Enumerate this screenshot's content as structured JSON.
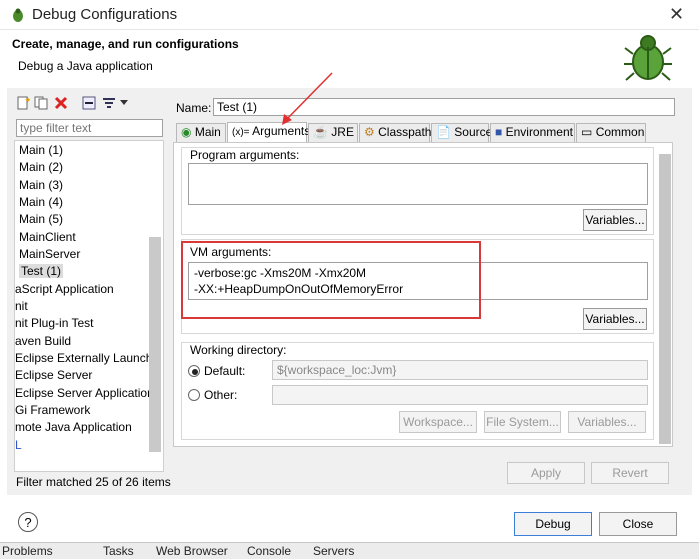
{
  "window": {
    "title": "Debug Configurations",
    "close_icon": "close-icon"
  },
  "header": {
    "heading": "Create, manage, and run configurations",
    "subheading": "Debug a Java application"
  },
  "left": {
    "filter_placeholder": "type filter text",
    "items": [
      {
        "label": "Main (1)"
      },
      {
        "label": "Main (2)"
      },
      {
        "label": "Main (3)"
      },
      {
        "label": "Main (4)"
      },
      {
        "label": "Main (5)"
      },
      {
        "label": "MainClient"
      },
      {
        "label": "MainServer"
      },
      {
        "label": "Test (1)",
        "selected": true
      },
      {
        "label": "aScript Application"
      },
      {
        "label": "nit"
      },
      {
        "label": "nit Plug-in Test"
      },
      {
        "label": "aven Build"
      },
      {
        "label": "Eclipse Externally Launche"
      },
      {
        "label": "Eclipse Server"
      },
      {
        "label": "Eclipse Server Application"
      },
      {
        "label": "Gi Framework"
      },
      {
        "label": "mote Java Application"
      },
      {
        "label": "L"
      }
    ],
    "status": "Filter matched 25 of 26 items"
  },
  "right": {
    "name_label": "Name:",
    "name_value": "Test (1)",
    "tabs": [
      "Main",
      "Arguments",
      "JRE",
      "Classpath",
      "Source",
      "Environment",
      "Common"
    ],
    "program_args_label": "Program arguments:",
    "variables_btn": "Variables...",
    "vm_args_label": "VM arguments:",
    "vm_args_line1": "-verbose:gc -Xms20M -Xmx20M",
    "vm_args_line2": "-XX:+HeapDumpOnOutOfMemoryError",
    "workdir_label": "Working directory:",
    "default_label": "Default:",
    "default_value": "${workspace_loc:Jvm}",
    "other_label": "Other:",
    "workspace_btn": "Workspace...",
    "filesystem_btn": "File System...",
    "variables_btn2": "Variables...",
    "apply_btn": "Apply",
    "revert_btn": "Revert"
  },
  "footer": {
    "debug_btn": "Debug",
    "close_btn": "Close"
  },
  "taskbar": {
    "items": [
      "Problems",
      "Tasks",
      "Web Browser",
      "Console",
      "Servers"
    ]
  }
}
